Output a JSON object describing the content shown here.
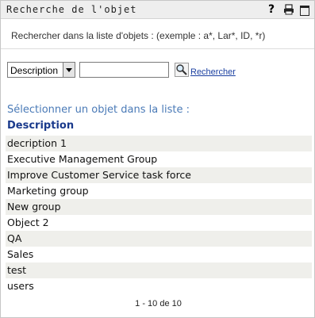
{
  "window": {
    "title": "Recherche de l'objet",
    "help_glyph": "?"
  },
  "instructions": "Rechercher dans la liste d'objets : (exemple : a*, Lar*, ID, *r)",
  "search": {
    "attribute_selected": "Description",
    "query_value": "",
    "button_label": "Rechercher"
  },
  "list": {
    "title": "Sélectionner un objet dans la liste :",
    "column_header": "Description",
    "items": [
      "decription 1",
      "Executive Management Group",
      "Improve Customer Service task force",
      "Marketing group",
      "New group",
      "Object 2",
      "QA",
      "Sales",
      "test",
      "users"
    ]
  },
  "pagination": "1 - 10 de 10",
  "colors": {
    "link_blue": "#1a3fa0",
    "header_blue": "#1a3a8c",
    "title_blue": "#4a7ab7",
    "row_alt": "#efefeb"
  }
}
